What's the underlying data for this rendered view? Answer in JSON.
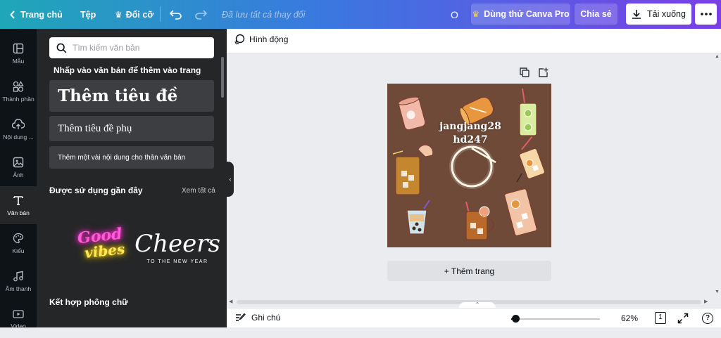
{
  "topbar": {
    "home_label": "Trang chủ",
    "file_label": "Tệp",
    "resize_label": "Đổi cỡ",
    "saved_status": "Đã lưu tất cả thay đổi",
    "user_initial": "O",
    "pro_label": "Dùng thử Canva Pro",
    "share_label": "Chia sẻ",
    "download_label": "Tải xuống"
  },
  "rail": {
    "items": [
      {
        "label": "Mẫu",
        "icon": "layout-icon"
      },
      {
        "label": "Thành phần",
        "icon": "shapes-icon"
      },
      {
        "label": "Nội dung ...",
        "icon": "cloud-upload-icon"
      },
      {
        "label": "Ảnh",
        "icon": "image-icon"
      },
      {
        "label": "Văn bản",
        "icon": "text-icon"
      },
      {
        "label": "Kiểu",
        "icon": "palette-icon"
      },
      {
        "label": "Âm thanh",
        "icon": "music-note-icon"
      },
      {
        "label": "Video",
        "icon": "video-icon"
      }
    ]
  },
  "panel": {
    "search_placeholder": "Tìm kiếm văn bản",
    "hint": "Nhấp vào văn bản để thêm vào trang",
    "heading": "Thêm tiêu đề",
    "subheading": "Thêm tiêu đề phụ",
    "body": "Thêm một vài nội dung cho thân văn bản",
    "recent_title": "Được sử dụng gần đây",
    "see_all": "Xem tất cả",
    "recent": [
      {
        "line1": "Good",
        "line2": "vibes"
      },
      {
        "line1": "Cheers",
        "line2": "TO THE NEW YEAR"
      }
    ],
    "font_combos_title": "Kết hợp phông chữ"
  },
  "editor": {
    "animate_label": "Hình động",
    "canvas_text_line1": "jangjang28",
    "canvas_text_line2": "hd247",
    "canvas_bg": "#6f4a38",
    "add_page_label": "+ Thêm trang"
  },
  "bottombar": {
    "notes_label": "Ghi chú",
    "zoom": "62%",
    "zoom_fraction": 0.05,
    "page_count": "1",
    "help": "?"
  },
  "colors": {
    "accent_gradient_start": "#1fa7b8",
    "accent_gradient_end": "#7a3fe6",
    "rail_bg": "#0e1318",
    "panel_bg": "#252627"
  }
}
